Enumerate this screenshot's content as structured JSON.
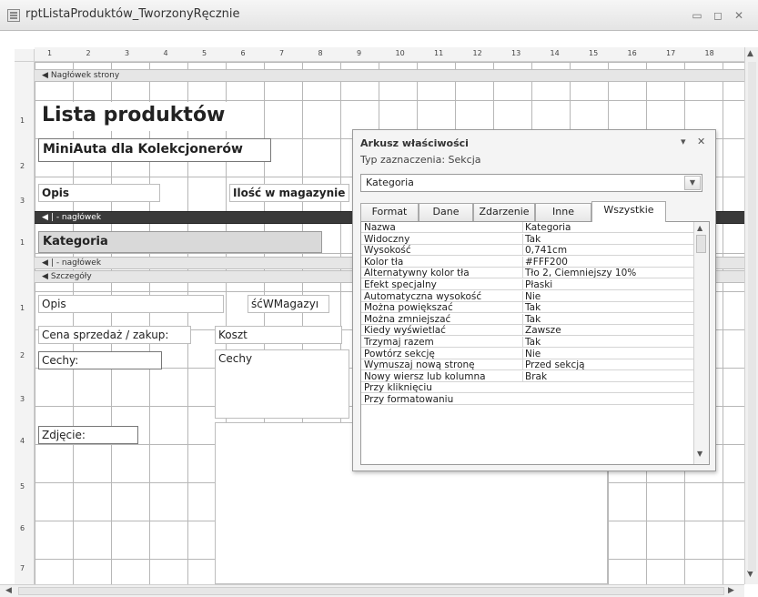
{
  "window": {
    "title": "rptListaProduktów_TworzonyRęcznie",
    "minimize_glyph": "▭",
    "maximize_glyph": "◻",
    "close_glyph": "✕"
  },
  "ruler": {
    "top_numbers": [
      "1",
      "2",
      "3",
      "4",
      "5",
      "6",
      "7",
      "8",
      "9",
      "10",
      "11",
      "12",
      "13",
      "14",
      "15",
      "16",
      "17",
      "18"
    ],
    "left_numbers": [
      "1",
      "2",
      "3",
      "1",
      "1",
      "2",
      "3",
      "4",
      "5",
      "6",
      "7"
    ]
  },
  "sections": {
    "page_header": "Nagłówek strony",
    "group_header": "| - nagłówek",
    "group_header2": "| - nagłówek",
    "detail": "Szczegóły",
    "marker_glyph": "◀"
  },
  "report": {
    "title": "Lista produktów",
    "subtitle": "MiniAuta dla Kolekcjonerów",
    "col_opis": "Opis",
    "col_ilosc": "Ilość w magazynie",
    "group_kategoria": "Kategoria",
    "detail_opis": "Opis",
    "detail_ilosc": "śćWMagazyı",
    "label_cena": "Cena sprzedaż / zakup:",
    "field_koszt": "Koszt",
    "label_cechy": "Cechy:",
    "field_cechy": "Cechy",
    "label_zdjecie": "Zdjęcie:"
  },
  "property_sheet": {
    "title": "Arkusz właściwości",
    "selection_type": "Typ zaznaczenia:  Sekcja",
    "selected_object": "Kategoria",
    "tabs": [
      "Format",
      "Dane",
      "Zdarzenie",
      "Inne",
      "Wszystkie"
    ],
    "active_tab": "Wszystkie",
    "properties": [
      {
        "name": "Nazwa",
        "value": "Kategoria"
      },
      {
        "name": "Widoczny",
        "value": "Tak"
      },
      {
        "name": "Wysokość",
        "value": "0,741cm"
      },
      {
        "name": "Kolor tła",
        "value": "#FFF200"
      },
      {
        "name": "Alternatywny kolor tła",
        "value": "Tło 2, Ciemniejszy 10%"
      },
      {
        "name": "Efekt specjalny",
        "value": "Płaski"
      },
      {
        "name": "Automatyczna wysokość",
        "value": "Nie"
      },
      {
        "name": "Można powiększać",
        "value": "Tak"
      },
      {
        "name": "Można zmniejszać",
        "value": "Tak"
      },
      {
        "name": "Kiedy wyświetlać",
        "value": "Zawsze"
      },
      {
        "name": "Trzymaj razem",
        "value": "Tak"
      },
      {
        "name": "Powtórz sekcję",
        "value": "Nie"
      },
      {
        "name": "Wymuszaj nową stronę",
        "value": "Przed sekcją"
      },
      {
        "name": "Nowy wiersz lub kolumna",
        "value": "Brak"
      },
      {
        "name": "Przy kliknięciu",
        "value": ""
      },
      {
        "name": "Przy formatowaniu",
        "value": ""
      }
    ]
  },
  "colors": {
    "section_dark": "#3a3a3a",
    "grid": "#9a9a9a"
  },
  "icons": {
    "dropdown": "chevron-down-icon",
    "close": "close-icon"
  }
}
